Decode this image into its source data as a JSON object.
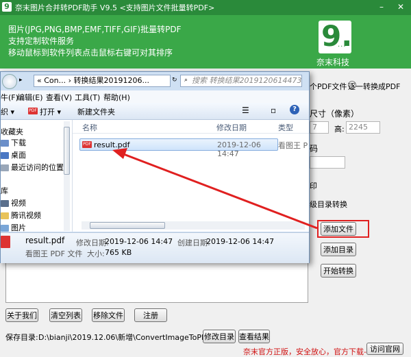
{
  "app": {
    "title": "奈末图片合并转PDF助手 V9.5  <支持图片文件批量转PDF>",
    "logo_char": "9",
    "brand_logo_text": "9.",
    "brand_logo_dots": "...",
    "brand_name": "奈末科技",
    "banner_lines": [
      "图片(JPG,PNG,BMP,EMF,TIFF,GIF)批量转PDF",
      "支持定制软件服务",
      "移动鼠标到软件列表点击鼠标右键可对其排序"
    ]
  },
  "options": {
    "merge_label": "个PDF文件",
    "each_label": "逐一转换成PDF",
    "size_label": "尺寸（像素）",
    "width_value": "7",
    "height_label": "高:",
    "height_value": "2245",
    "code_label": "码",
    "print_label": "印",
    "subdir_label": "级目录转换"
  },
  "buttons": {
    "add_file": "添加文件",
    "add_dir": "添加目录",
    "start": "开始转换",
    "about": "关于我们",
    "clear": "清空列表",
    "remove": "移除文件",
    "register": "注册",
    "modify_dir": "修改目录",
    "view_result": "查看结果",
    "visit_site": "访问官网"
  },
  "save": {
    "label": "保存目录:",
    "path": "D:\\bianji\\2019.12.06\\新增\\ConvertImageToPDF"
  },
  "footer_note": "奈末官方正版，安全放心，官方下载-->",
  "explorer": {
    "address": "« Con... › 转换结果20191206...",
    "search_placeholder": "搜索 转换结果20191206144738",
    "menu": [
      "牛(F)",
      "编辑(E)",
      "查看(V)",
      "工具(T)",
      "帮助(H)"
    ],
    "toolbar": {
      "organize": "织 ▾",
      "open": "打开 ▾",
      "new_folder": "新建文件夹"
    },
    "sidebar": [
      {
        "label": "收藏夹",
        "bold": true
      },
      {
        "label": "下载"
      },
      {
        "label": "桌面"
      },
      {
        "label": "最近访问的位置"
      },
      {
        "label": ""
      },
      {
        "label": "库",
        "bold": true
      },
      {
        "label": "视频"
      },
      {
        "label": "腾讯视频"
      },
      {
        "label": "图片"
      }
    ],
    "columns": {
      "name": "名称",
      "modified": "修改日期",
      "type": "类型"
    },
    "file": {
      "name": "result.pdf",
      "modified": "2019-12-06 14:47",
      "type": "看图王 P"
    },
    "pdf_icon_label": "PDF",
    "details": {
      "name": "result.pdf",
      "type": "看图王 PDF 文件",
      "modified_label": "修改日期:",
      "modified": "2019-12-06 14:47",
      "created_label": "创建日期:",
      "created": "2019-12-06 14:47",
      "size_label": "大小:",
      "size": "765 KB"
    }
  },
  "colors": {
    "banner_green": "#3aa848",
    "title_green": "#2a8a3a",
    "highlight_red": "#e02020"
  }
}
